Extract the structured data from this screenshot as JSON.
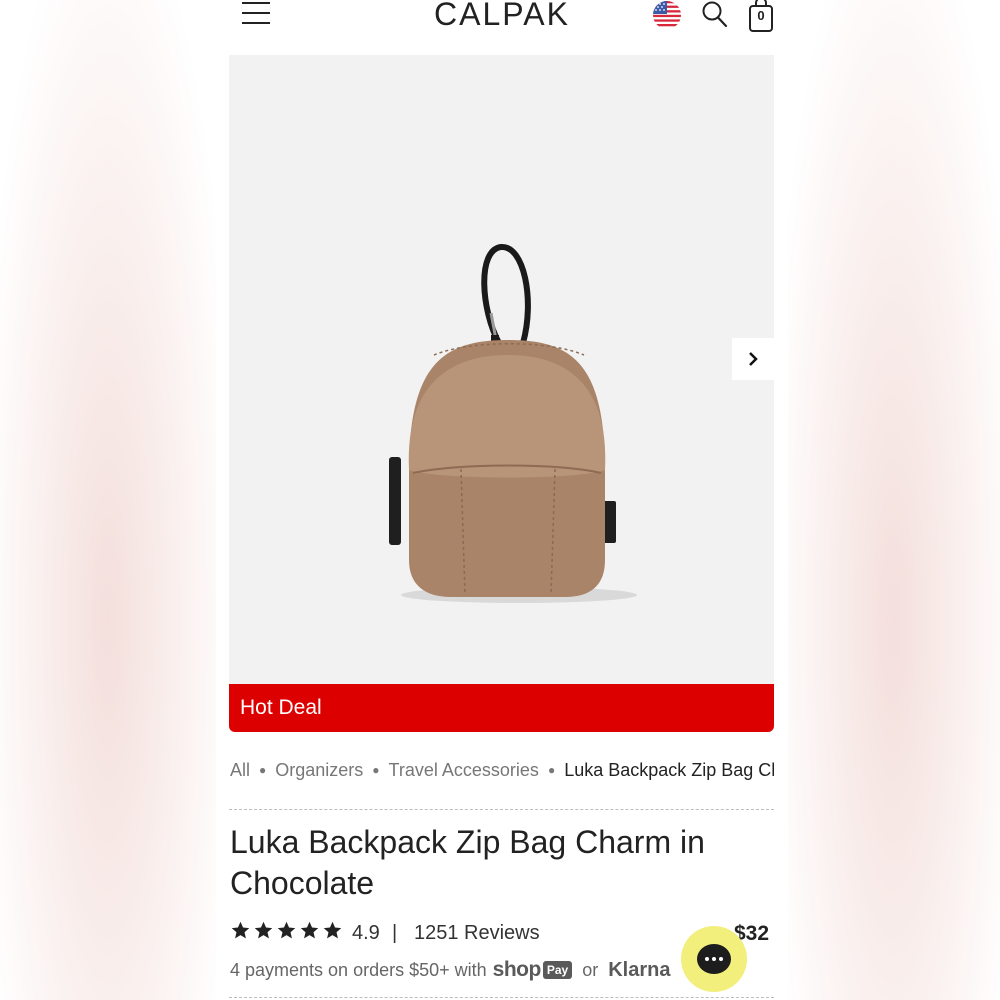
{
  "header": {
    "logo": "CALPAK",
    "cart_count": "0",
    "icons": [
      "menu-icon",
      "us-flag-icon",
      "search-icon",
      "shopping-bag-icon"
    ]
  },
  "product": {
    "badge": "Hot Deal",
    "title": "Luka Backpack Zip Bag Charm in Chocolate",
    "rating": "4.9",
    "rating_separator": "|",
    "reviews": "1251 Reviews",
    "stars": 5,
    "price": "$32",
    "image_icon": "backpack-charm-image"
  },
  "breadcrumb": {
    "items": [
      "All",
      "Organizers",
      "Travel Accessories"
    ],
    "current": "Luka Backpack Zip Bag Charm"
  },
  "payments": {
    "text": "4 payments on orders $50+ with",
    "shop": "shop",
    "pay": "Pay",
    "or": "or",
    "klarna": "Klarna"
  },
  "colors": {
    "hot_deal": "#dd0000",
    "image_bg": "#f2f2f2",
    "chat_button": "#f2ef7d",
    "bag_body": "#a98468"
  }
}
